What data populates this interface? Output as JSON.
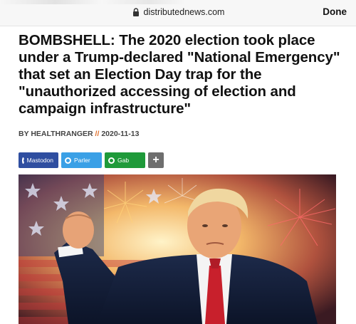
{
  "browser": {
    "url": "distributednews.com",
    "done_label": "Done"
  },
  "article": {
    "headline": "BOMBSHELL: The 2020 election took place under a Trump-declared \"National Emergency\" that set an Election Day trap for the \"unauthorized accessing of election and campaign infrastructure\"",
    "author": "BY HEALTHRANGER",
    "separator": "//",
    "date": "2020-11-13"
  },
  "share": {
    "buttons": [
      {
        "label": "Mastodon",
        "icon": "mastodon-icon",
        "color": "#2f4ea0"
      },
      {
        "label": "Parler",
        "icon": "parler-icon",
        "color": "#3aa0e6"
      },
      {
        "label": "Gab",
        "icon": "gab-icon",
        "color": "#1f9a3a"
      }
    ],
    "more_label": "+"
  }
}
